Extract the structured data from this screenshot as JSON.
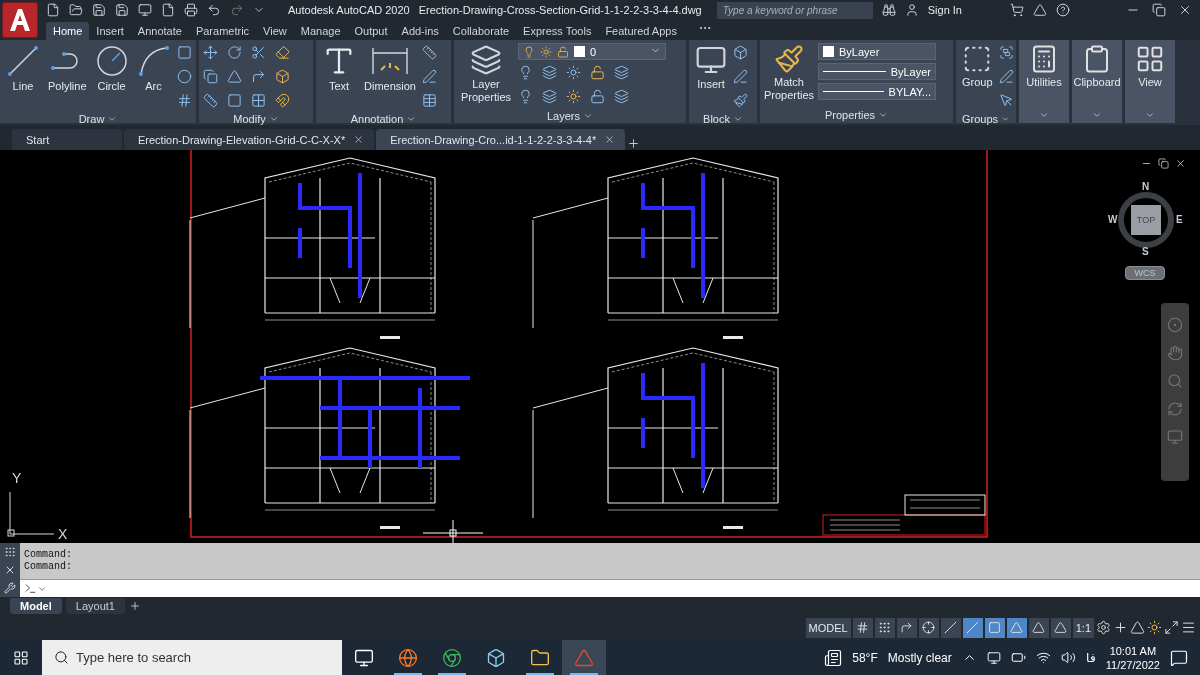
{
  "title_bar": {
    "app_title": "Autodesk AutoCAD 2020",
    "file_name": "Erection-Drawing-Cross-Section-Grid-1-1-2-2-3-3-4-4.dwg",
    "search": {
      "placeholder": "Type a keyword or phrase"
    },
    "sign_in": "Sign In"
  },
  "ribbon_tabs": [
    {
      "label": "Home",
      "selected": true
    },
    {
      "label": "Insert",
      "selected": false
    },
    {
      "label": "Annotate",
      "selected": false
    },
    {
      "label": "Parametric",
      "selected": false
    },
    {
      "label": "View",
      "selected": false
    },
    {
      "label": "Manage",
      "selected": false
    },
    {
      "label": "Output",
      "selected": false
    },
    {
      "label": "Add-ins",
      "selected": false
    },
    {
      "label": "Collaborate",
      "selected": false
    },
    {
      "label": "Express Tools",
      "selected": false
    },
    {
      "label": "Featured Apps",
      "selected": false
    }
  ],
  "ribbon_panels": [
    {
      "kind": "draw",
      "title": "Draw",
      "tools": [
        "Line",
        "Polyline",
        "Circle",
        "Arc"
      ]
    },
    {
      "kind": "modify",
      "title": "Modify"
    },
    {
      "kind": "annotation",
      "title": "Annotation",
      "tools": [
        "Text",
        "Dimension"
      ]
    },
    {
      "kind": "layers",
      "title": "Layers",
      "tools": [
        "Layer Properties"
      ],
      "current_layer": "0"
    },
    {
      "kind": "block",
      "title": "Block",
      "tools": [
        "Insert"
      ]
    },
    {
      "kind": "properties",
      "title": "Properties",
      "tools": [
        "Match Properties"
      ],
      "color_setting": "ByLayer",
      "lineweight": "ByLayer",
      "linetype": "BYLAY..."
    },
    {
      "kind": "groups",
      "title": "Groups",
      "tools": [
        "Group"
      ]
    },
    {
      "kind": "collapsed",
      "title": "Utilities"
    },
    {
      "kind": "collapsed",
      "title": "Clipboard"
    },
    {
      "kind": "collapsed",
      "title": "View"
    }
  ],
  "file_tabs": [
    {
      "label": "Start",
      "selected": false,
      "closable": false
    },
    {
      "label": "Erection-Drawing-Elevation-Grid-C-C-X-X*",
      "selected": false,
      "closable": true
    },
    {
      "label": "Erection-Drawing-Cro...id-1-1-2-2-3-3-4-4*",
      "selected": true,
      "closable": true
    }
  ],
  "viewcube": {
    "north": "N",
    "east": "E",
    "south": "S",
    "west": "W",
    "face": "TOP",
    "ucs": "WCS"
  },
  "ucs_icon": {
    "x_label": "X",
    "y_label": "Y"
  },
  "command_line": {
    "history": [
      "Command:",
      "Command:"
    ]
  },
  "layout_tabs": [
    {
      "label": "Model",
      "selected": true
    },
    {
      "label": "Layout1",
      "selected": false
    }
  ],
  "status_bar": {
    "space": "MODEL",
    "scale": "1:1",
    "toggles": [
      {
        "on": false
      },
      {
        "on": false
      },
      {
        "on": false
      },
      {
        "on": false
      },
      {
        "on": false
      },
      {
        "on": true
      },
      {
        "on": true
      },
      {
        "on": true
      },
      {
        "on": false
      },
      {
        "on": false
      }
    ]
  },
  "taskbar": {
    "search": {
      "placeholder": "Type here to search"
    },
    "apps": [
      {
        "running": false,
        "selected": false
      },
      {
        "running": true,
        "selected": false
      },
      {
        "running": true,
        "selected": false
      },
      {
        "running": false,
        "selected": false
      },
      {
        "running": true,
        "selected": false
      },
      {
        "running": true,
        "selected": true
      }
    ],
    "temperature": "58°F",
    "weather": "Mostly clear",
    "language": "فا",
    "time": "10:01 AM",
    "date": "11/27/2022"
  }
}
